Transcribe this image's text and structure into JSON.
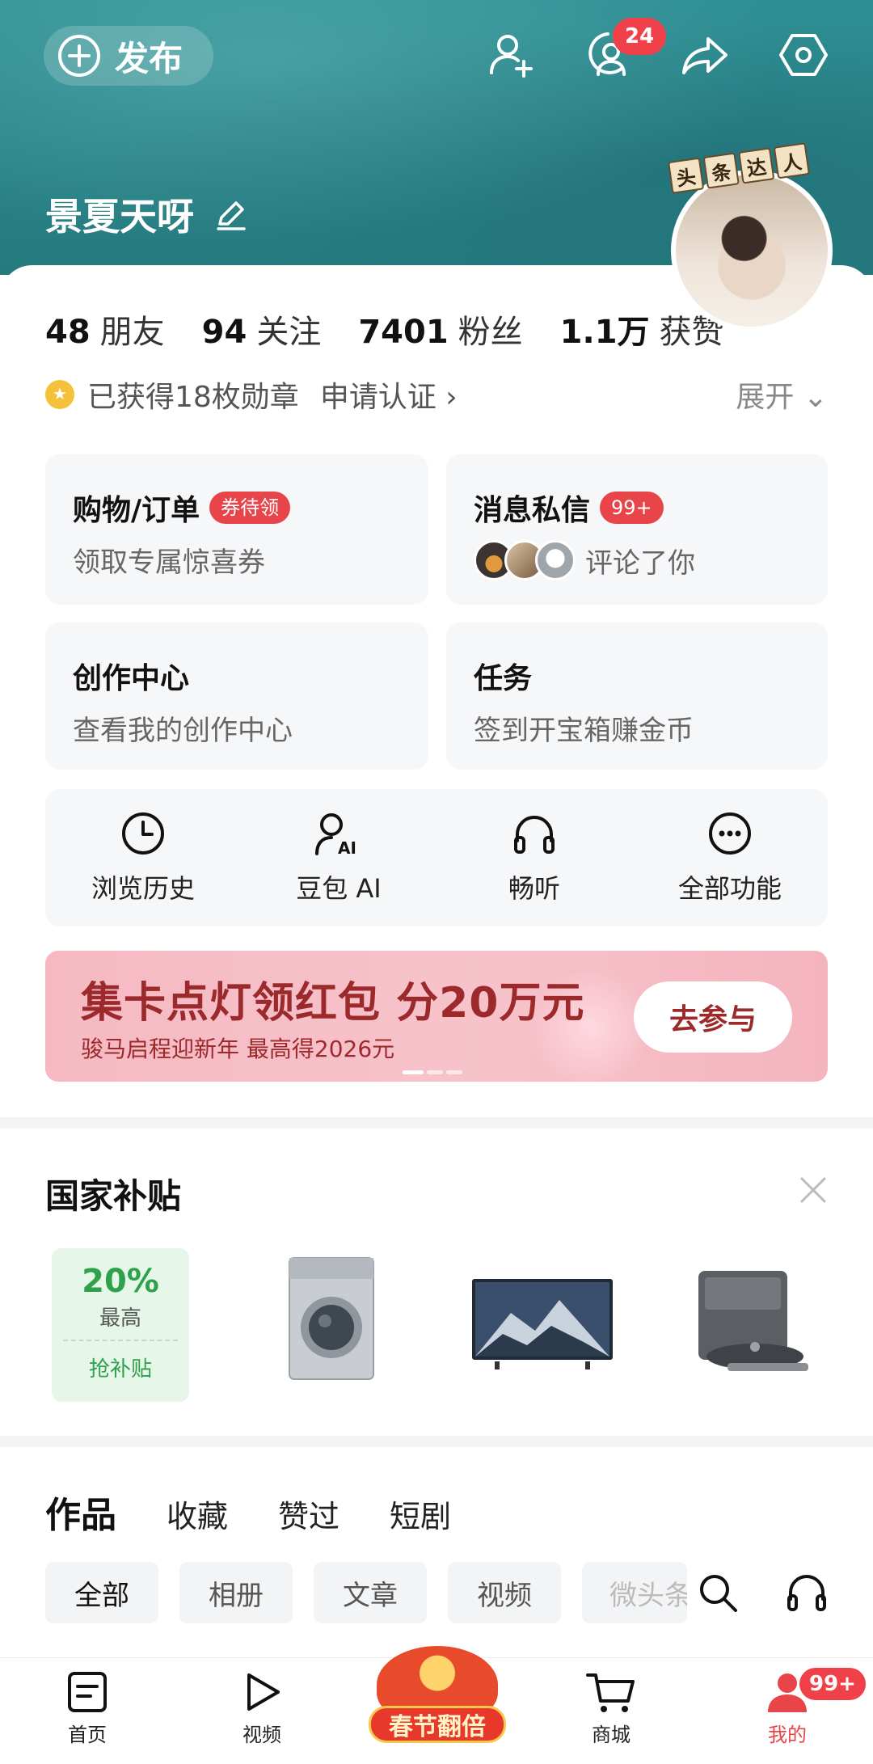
{
  "header": {
    "publish_label": "发布",
    "notification_badge": "24",
    "username": "景夏天呀",
    "talent_tag": [
      "头",
      "条",
      "达",
      "人"
    ]
  },
  "stats": [
    {
      "num": "48",
      "label": "朋友"
    },
    {
      "num": "94",
      "label": "关注"
    },
    {
      "num": "7401",
      "label": "粉丝"
    },
    {
      "num": "1.1万",
      "label": "获赞"
    }
  ],
  "medal": {
    "text": "已获得18枚勋章",
    "cert": "申请认证 ›",
    "expand": "展开 ⌄"
  },
  "cards": {
    "shopping": {
      "title": "购物/订单",
      "badge": "券待领",
      "sub": "领取专属惊喜券"
    },
    "messages": {
      "title": "消息私信",
      "badge": "99+",
      "sub": "评论了你"
    },
    "creation": {
      "title": "创作中心",
      "sub": "查看我的创作中心"
    },
    "tasks": {
      "title": "任务",
      "sub": "签到开宝箱赚金币"
    }
  },
  "tools": [
    {
      "label": "浏览历史",
      "icon": "clock-icon"
    },
    {
      "label": "豆包 AI",
      "icon": "ai-assistant-icon"
    },
    {
      "label": "畅听",
      "icon": "headphones-icon"
    },
    {
      "label": "全部功能",
      "icon": "more-icon"
    }
  ],
  "banner": {
    "title": "集卡点灯领红包 分20万元",
    "sub": "骏马启程迎新年  最高得2026元",
    "button": "去参与"
  },
  "subsidy": {
    "title": "国家补贴",
    "coupon_pct": "20%",
    "coupon_high": "最高",
    "coupon_grab": "抢补贴",
    "products": [
      "washing-machine",
      "tv",
      "robot-vacuum"
    ]
  },
  "content_tabs": [
    "作品",
    "收藏",
    "赞过",
    "短剧"
  ],
  "filters": [
    "全部",
    "相册",
    "文章",
    "视频",
    "微头条"
  ],
  "bottom_nav": {
    "home": "首页",
    "video": "视频",
    "festival": "春节翻倍",
    "mall": "商城",
    "mine": "我的",
    "mine_badge": "99+"
  },
  "colors": {
    "accent_red": "#e8454a",
    "header_teal": "#2a8488",
    "subsidy_green": "#2fa14a",
    "banner_text": "#9c2a2c"
  }
}
